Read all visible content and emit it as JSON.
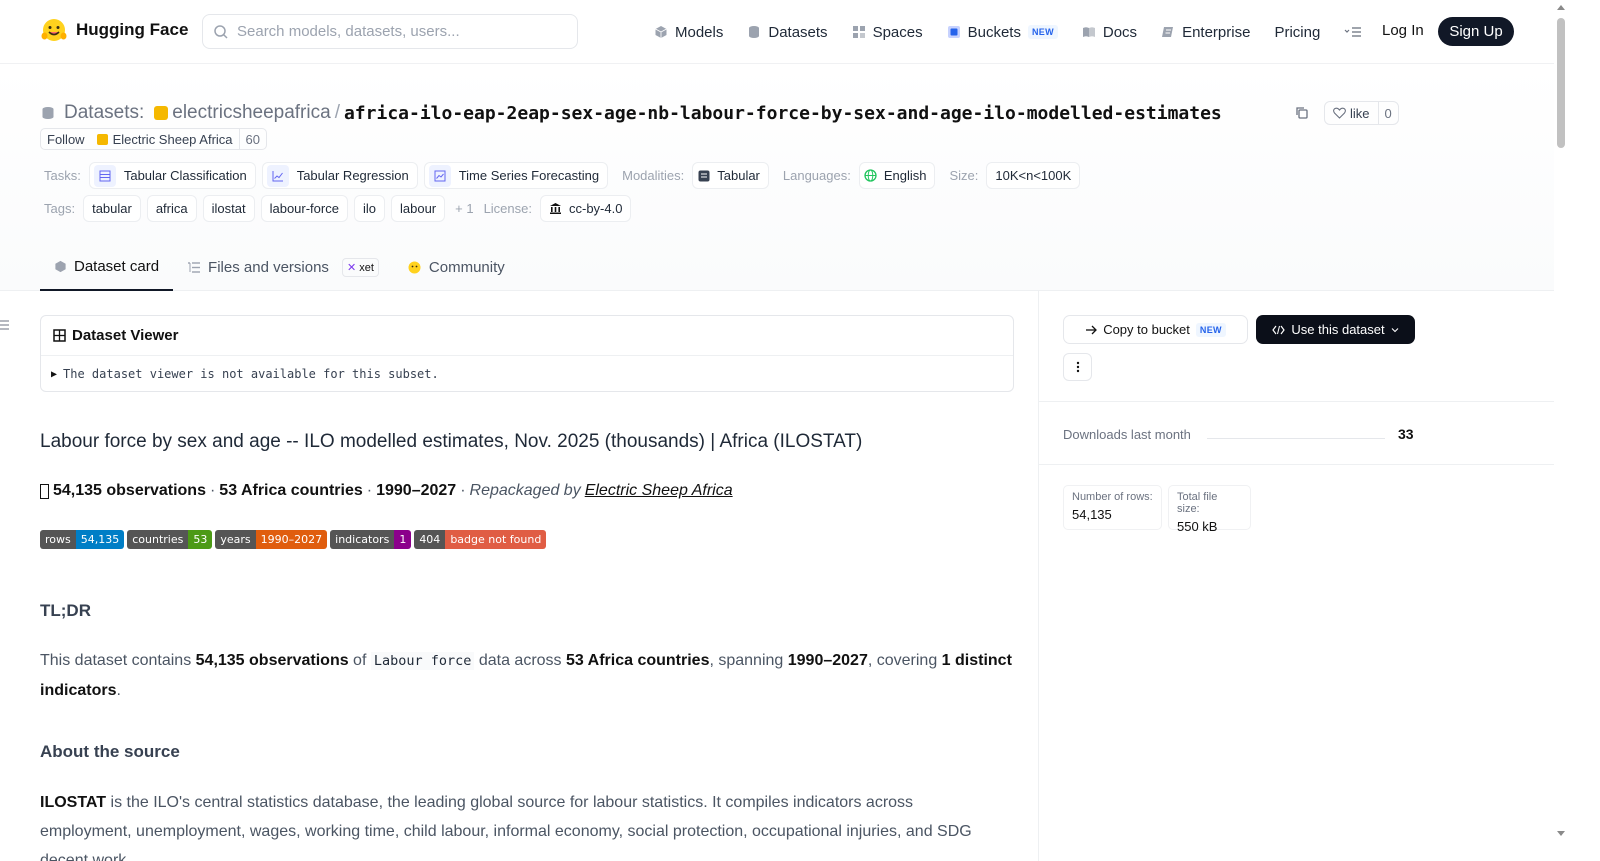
{
  "nav": {
    "brand": "Hugging Face",
    "search_placeholder": "Search models, datasets, users...",
    "links": [
      "Models",
      "Datasets",
      "Spaces",
      "Buckets",
      "Docs",
      "Enterprise",
      "Pricing"
    ],
    "new_badge": "NEW",
    "login": "Log In",
    "signup": "Sign Up"
  },
  "header": {
    "datasets_label": "Datasets:",
    "org": "electricsheepafrica",
    "slash": "/",
    "dataset_name": "africa-ilo-eap-2eap-sex-age-nb-labour-force-by-sex-and-age-ilo-modelled-estimates",
    "like_label": "like",
    "like_count": "0",
    "follow_label": "Follow",
    "follow_org": "Electric Sheep Africa",
    "follow_count": "60",
    "tasks_label": "Tasks:",
    "tasks": [
      "Tabular Classification",
      "Tabular Regression",
      "Time Series Forecasting"
    ],
    "modalities_label": "Modalities:",
    "modality": "Tabular",
    "languages_label": "Languages:",
    "language": "English",
    "size_label": "Size:",
    "size": "10K<n<100K",
    "tags_label": "Tags:",
    "tags": [
      "tabular",
      "africa",
      "ilostat",
      "labour-force",
      "ilo",
      "labour"
    ],
    "tags_more": "+ 1",
    "license_label": "License:",
    "license": "cc-by-4.0"
  },
  "tabs": {
    "card": "Dataset card",
    "files": "Files and versions",
    "xet": "xet",
    "community": "Community"
  },
  "viewer": {
    "title": "Dataset Viewer",
    "message": "The dataset viewer is not available for this subset."
  },
  "content": {
    "title": "Labour force by sex and age -- ILO modelled estimates, Nov. 2025 (thousands) | Africa (ILOSTAT)",
    "summary_obs": "54,135 observations",
    "summary_sep": "·",
    "summary_countries": "53 Africa countries",
    "summary_years": "1990–2027",
    "summary_by": "Repackaged by",
    "summary_link": "Electric Sheep Africa",
    "badges": [
      {
        "k": "rows",
        "v": "54,135",
        "color": "#007ec6"
      },
      {
        "k": "countries",
        "v": "53",
        "color": "#4c9a16"
      },
      {
        "k": "years",
        "v": "1990–2027",
        "color": "#e05d0e"
      },
      {
        "k": "indicators",
        "v": "1",
        "color": "#8b008b"
      },
      {
        "k": "404",
        "v": "badge not found",
        "color": "#e05d44"
      }
    ],
    "tldr_heading": "TL;DR",
    "tldr_1": "This dataset contains ",
    "tldr_obs": "54,135 observations",
    "tldr_2": " of ",
    "tldr_code": "Labour force",
    "tldr_3": " data across ",
    "tldr_countries": "53 Africa countries",
    "tldr_4": ", spanning ",
    "tldr_years": "1990–2027",
    "tldr_5": ", covering ",
    "tldr_ind": "1 distinct indicators",
    "tldr_6": ".",
    "about_heading": "About the source",
    "about_bold": "ILOSTAT",
    "about_text": " is the ILO's central statistics database, the leading global source for labour statistics. It compiles indicators across employment, unemployment, wages, working time, child labour, informal economy, social protection, occupational injuries, and SDG decent work"
  },
  "sidebar": {
    "copy_bucket": "Copy to bucket",
    "new_badge": "NEW",
    "use_dataset": "Use this dataset",
    "downloads_label": "Downloads last month",
    "downloads_value": "33",
    "rows_label": "Number of rows:",
    "rows_value": "54,135",
    "size_label": "Total file size:",
    "size_value": "550 kB"
  }
}
